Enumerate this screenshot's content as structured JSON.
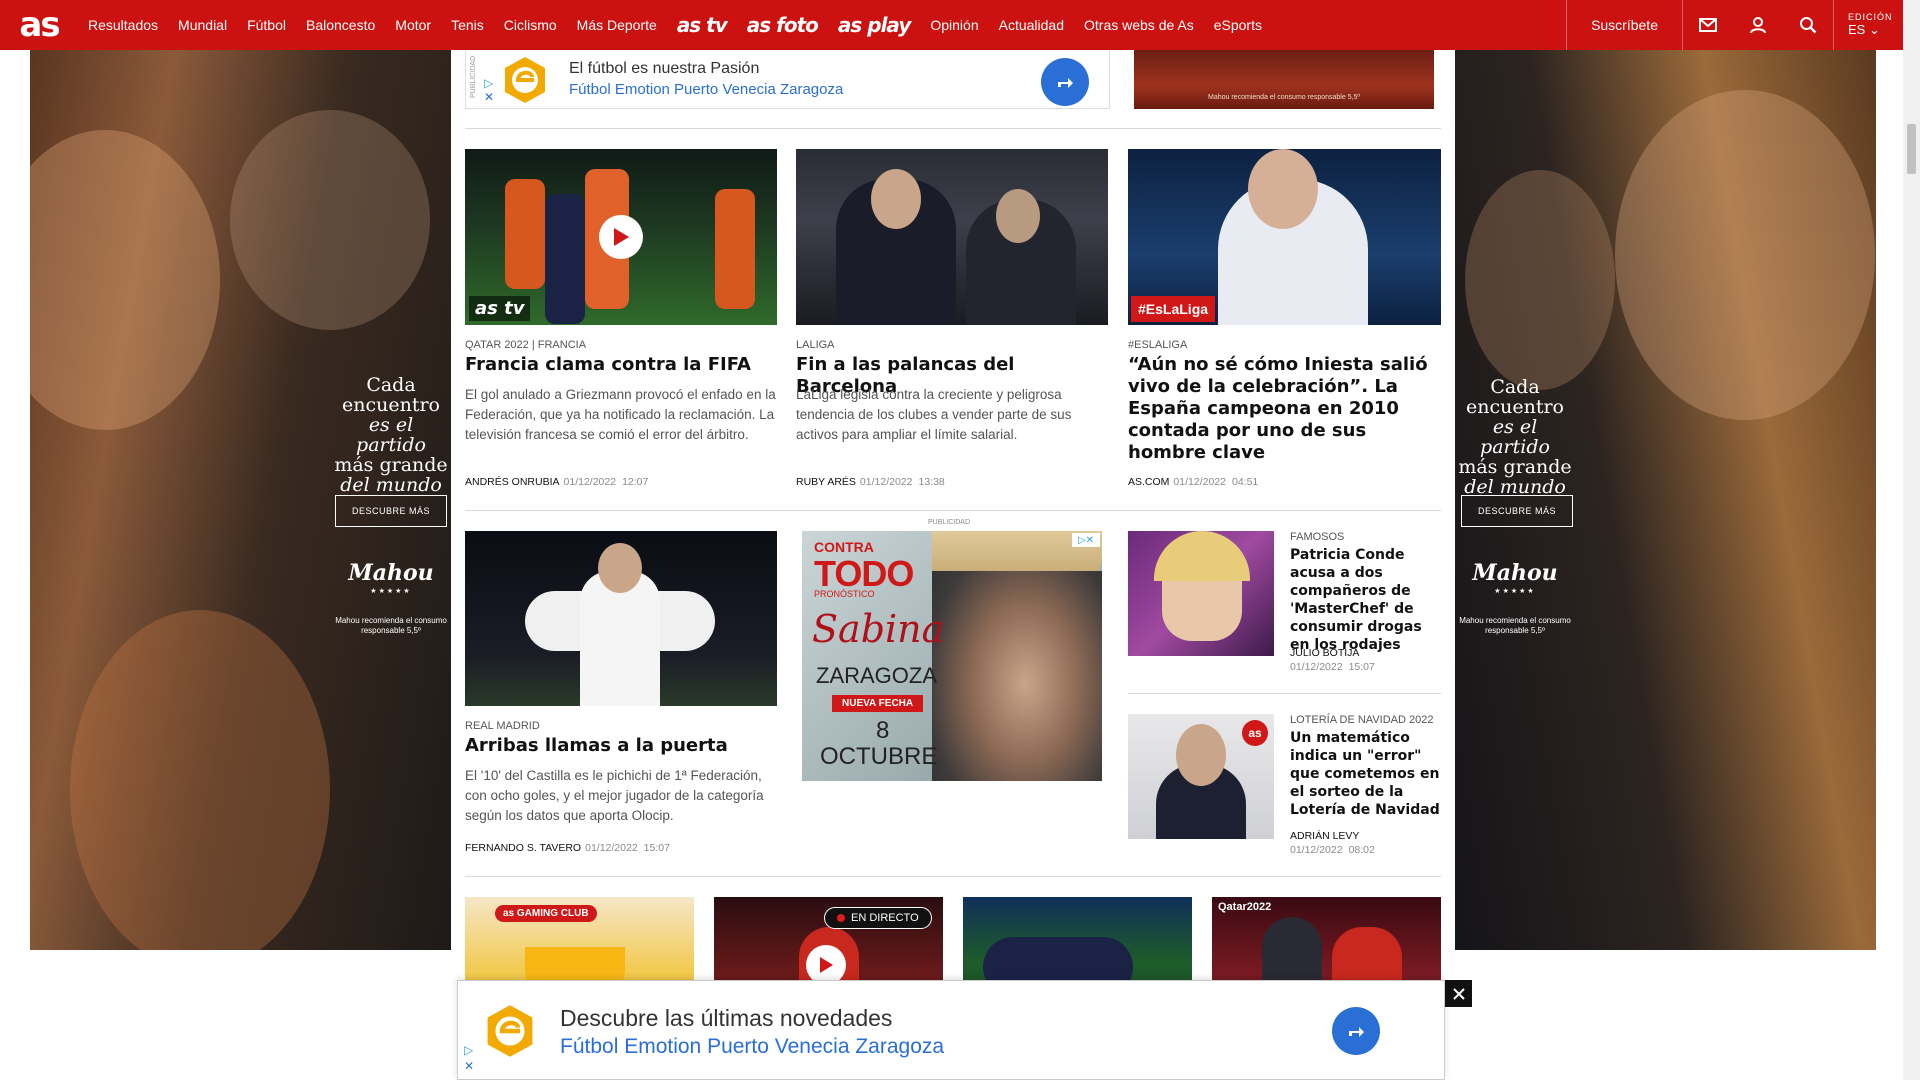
{
  "header": {
    "logo": "as",
    "nav": [
      "Resultados",
      "Mundial",
      "Fútbol",
      "Baloncesto",
      "Motor",
      "Tenis",
      "Ciclismo",
      "Más Deporte"
    ],
    "brand_links": [
      "as tv",
      "as foto",
      "as play"
    ],
    "nav2": [
      "Opinión",
      "Actualidad",
      "Otras webs de As",
      "eSports"
    ],
    "subscribe": "Suscríbete",
    "edition_label": "EDICIÓN",
    "edition_value": "ES",
    "icons": [
      "mail-icon",
      "user-icon",
      "search-icon",
      "chevron-down-icon"
    ]
  },
  "side_ads": {
    "tagline_l1": "Cada",
    "tagline_l2": "encuentro",
    "tagline_l3": "es el partido",
    "tagline_l4": "más grande",
    "tagline_l5": "del mundo",
    "cta": "DESCUBRE MÁS",
    "brand": "Mahou",
    "stars": "★★★★★",
    "disclaimer": "Mahou recomienda el consumo responsable 5,5º"
  },
  "top_ad": {
    "publicidad": "PUBLICIDAD",
    "line1": "El fútbol es nuestra Pasión",
    "line2": "Fútbol Emotion Puerto Venecia Zaragoza",
    "beer_disclaimer": "Mahou recomienda el consumo responsable 5,5º"
  },
  "articles_row1": [
    {
      "kicker": "QATAR 2022 | FRANCIA",
      "headline": "Francia clama contra la FIFA",
      "summary": "El gol anulado a Griezmann provocó el enfado en la Federación, que ya ha notificado la reclamación. La televisión francesa se comió el error del árbitro.",
      "author": "ANDRÉS ONRUBIA",
      "date": "01/12/2022",
      "time": "12:07",
      "badge": "as tv"
    },
    {
      "kicker": "LALIGA",
      "headline": "Fin a las palancas del Barcelona",
      "summary": "LaLiga legisla contra la creciente y peligrosa tendencia de los clubes a vender parte de sus activos para ampliar el límite salarial.",
      "author": "RUBY ARÉS",
      "date": "01/12/2022",
      "time": "13:38"
    },
    {
      "kicker": "#ESLALIGA",
      "headline": "“Aún no sé cómo Iniesta salió vivo de la celebración”. La España campeona en 2010 contada por uno de sus hombre clave",
      "author": "AS.COM",
      "date": "01/12/2022",
      "time": "04:51",
      "badge": "#EsLaLiga"
    }
  ],
  "article_row2": {
    "kicker": "REAL MADRID",
    "headline": "Arribas llamas a la puerta",
    "summary": "El '10' del Castilla es le pichichi de 1ª Federación, con ocho goles, y el mejor jugador de la categoría según los datos que aporta Olocip.",
    "author": "FERNANDO S. TAVERO",
    "date": "01/12/2022",
    "time": "15:07"
  },
  "mid_ad": {
    "label": "PUBLICIDAD",
    "l1": "CONTRA",
    "l2": "TODO",
    "l3": "PRONÓSTICO",
    "l4": "Sabina",
    "l5": "ZARAGOZA",
    "l6": "NUEVA FECHA",
    "l7": "8",
    "l8": "OCTUBRE"
  },
  "side_articles": [
    {
      "kicker": "FAMOSOS",
      "headline": "Patricia Conde acusa a dos compañeros de 'MasterChef' de consumir drogas en los rodajes",
      "author": "JULIO BOTIJA",
      "date": "01/12/2022",
      "time": "15:07"
    },
    {
      "kicker": "LOTERÍA DE NAVIDAD 2022",
      "headline": "Un matemático indica un \"error\" que cometemos en el sorteo de la Lotería de Navidad",
      "author": "ADRIÁN LEVY",
      "date": "01/12/2022",
      "time": "08:02",
      "badge": "as"
    }
  ],
  "row3": {
    "live": "EN DIRECTO",
    "card1_label": "as GAMING CLUB",
    "card4_label": "Qatar2022"
  },
  "sticky_ad": {
    "line1": "Descubre las últimas novedades",
    "line2": "Fútbol Emotion Puerto Venecia Zaragoza"
  },
  "colors": {
    "brand_red": "#cc1111",
    "ad_blue": "#2a6fd6",
    "ad_orange": "#f2a900"
  }
}
